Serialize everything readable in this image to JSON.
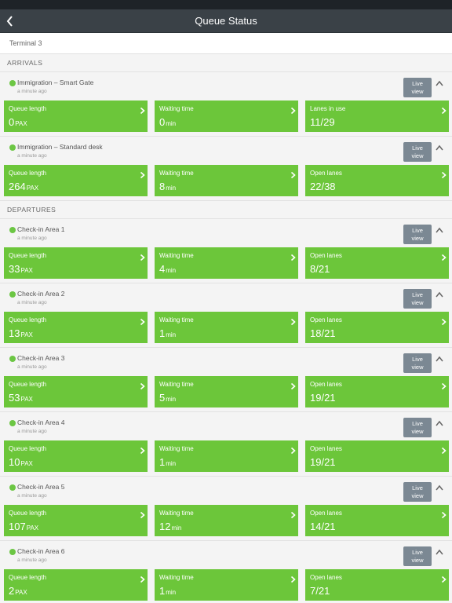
{
  "header": {
    "title": "Queue Status"
  },
  "terminal": {
    "name": "Terminal 3"
  },
  "live_label_1": "Live",
  "live_label_2": "view",
  "sections": [
    {
      "title": "ARRIVALS",
      "cards": [
        {
          "name": "Immigration – Smart Gate",
          "time": "a minute ago",
          "tiles": [
            {
              "label": "Queue length",
              "value": "0",
              "unit": "PAX"
            },
            {
              "label": "Waiting time",
              "value": "0",
              "unit": "min"
            },
            {
              "label": "Lanes in use",
              "value": "11/29",
              "unit": ""
            }
          ]
        },
        {
          "name": "Immigration – Standard desk",
          "time": "a minute ago",
          "tiles": [
            {
              "label": "Queue length",
              "value": "264",
              "unit": "PAX"
            },
            {
              "label": "Waiting time",
              "value": "8",
              "unit": "min"
            },
            {
              "label": "Open lanes",
              "value": "22/38",
              "unit": ""
            }
          ]
        }
      ]
    },
    {
      "title": "DEPARTURES",
      "cards": [
        {
          "name": "Check-in Area 1",
          "time": "a minute ago",
          "tiles": [
            {
              "label": "Queue length",
              "value": "33",
              "unit": "PAX"
            },
            {
              "label": "Waiting time",
              "value": "4",
              "unit": "min"
            },
            {
              "label": "Open lanes",
              "value": "8/21",
              "unit": ""
            }
          ]
        },
        {
          "name": "Check-in Area 2",
          "time": "a minute ago",
          "tiles": [
            {
              "label": "Queue length",
              "value": "13",
              "unit": "PAX"
            },
            {
              "label": "Waiting time",
              "value": "1",
              "unit": "min"
            },
            {
              "label": "Open lanes",
              "value": "18/21",
              "unit": ""
            }
          ]
        },
        {
          "name": "Check-in Area 3",
          "time": "a minute ago",
          "tiles": [
            {
              "label": "Queue length",
              "value": "53",
              "unit": "PAX"
            },
            {
              "label": "Waiting time",
              "value": "5",
              "unit": "min"
            },
            {
              "label": "Open lanes",
              "value": "19/21",
              "unit": ""
            }
          ]
        },
        {
          "name": "Check-in Area 4",
          "time": "a minute ago",
          "tiles": [
            {
              "label": "Queue length",
              "value": "10",
              "unit": "PAX"
            },
            {
              "label": "Waiting time",
              "value": "1",
              "unit": "min"
            },
            {
              "label": "Open lanes",
              "value": "19/21",
              "unit": ""
            }
          ]
        },
        {
          "name": "Check-in Area 5",
          "time": "a minute ago",
          "tiles": [
            {
              "label": "Queue length",
              "value": "107",
              "unit": "PAX"
            },
            {
              "label": "Waiting time",
              "value": "12",
              "unit": "min"
            },
            {
              "label": "Open lanes",
              "value": "14/21",
              "unit": ""
            }
          ]
        },
        {
          "name": "Check-in Area 6",
          "time": "a minute ago",
          "tiles": [
            {
              "label": "Queue length",
              "value": "2",
              "unit": "PAX"
            },
            {
              "label": "Waiting time",
              "value": "1",
              "unit": "min"
            },
            {
              "label": "Open lanes",
              "value": "7/21",
              "unit": ""
            }
          ]
        }
      ]
    }
  ],
  "colors": {
    "navbar": "#3a4147",
    "tile_green": "#6cc63a",
    "status_dot": "#6cc644",
    "live_button": "#7b8893"
  },
  "icons": {
    "back": "chevron-left-icon",
    "collapse": "chevron-up-icon",
    "tile": "chevron-right-icon",
    "status": "status-dot-icon"
  }
}
